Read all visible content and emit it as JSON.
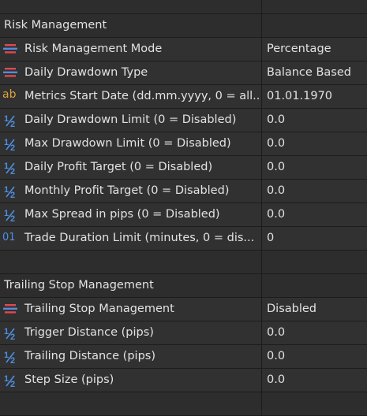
{
  "sections": [
    {
      "title": "Risk Management",
      "items": [
        {
          "icon": "enum-icon",
          "label": "Risk Management Mode",
          "value": "Percentage"
        },
        {
          "icon": "enum-icon",
          "label": "Daily Drawdown Type",
          "value": "Balance Based"
        },
        {
          "icon": "string-icon",
          "label": "Metrics Start Date (dd.mm.yyyy, 0 = all...",
          "value": "01.01.1970"
        },
        {
          "icon": "double-icon",
          "label": "Daily Drawdown Limit (0 = Disabled)",
          "value": "0.0"
        },
        {
          "icon": "double-icon",
          "label": "Max Drawdown Limit (0 = Disabled)",
          "value": "0.0"
        },
        {
          "icon": "double-icon",
          "label": "Daily Profit Target (0 = Disabled)",
          "value": "0.0"
        },
        {
          "icon": "double-icon",
          "label": "Monthly Profit Target (0 = Disabled)",
          "value": "0.0"
        },
        {
          "icon": "double-icon",
          "label": "Max Spread in pips (0 = Disabled)",
          "value": "0.0"
        },
        {
          "icon": "integer-icon",
          "label": "Trade Duration Limit (minutes, 0 = dis...",
          "value": "0"
        }
      ]
    },
    {
      "title": "Trailing Stop Management",
      "items": [
        {
          "icon": "enum-icon",
          "label": "Trailing Stop Management",
          "value": "Disabled"
        },
        {
          "icon": "double-icon",
          "label": "Trigger Distance (pips)",
          "value": "0.0"
        },
        {
          "icon": "double-icon",
          "label": "Trailing Distance (pips)",
          "value": "0.0"
        },
        {
          "icon": "double-icon",
          "label": "Step Size (pips)",
          "value": "0.0"
        }
      ]
    }
  ],
  "icon_glyphs": {
    "string-icon": "ab",
    "integer-icon": "01"
  },
  "colors": {
    "enum_red": "#e2484d",
    "enum_blue": "#4d8fe0",
    "string_orange": "#d9a23a",
    "double_blue": "#4d8fe0"
  }
}
